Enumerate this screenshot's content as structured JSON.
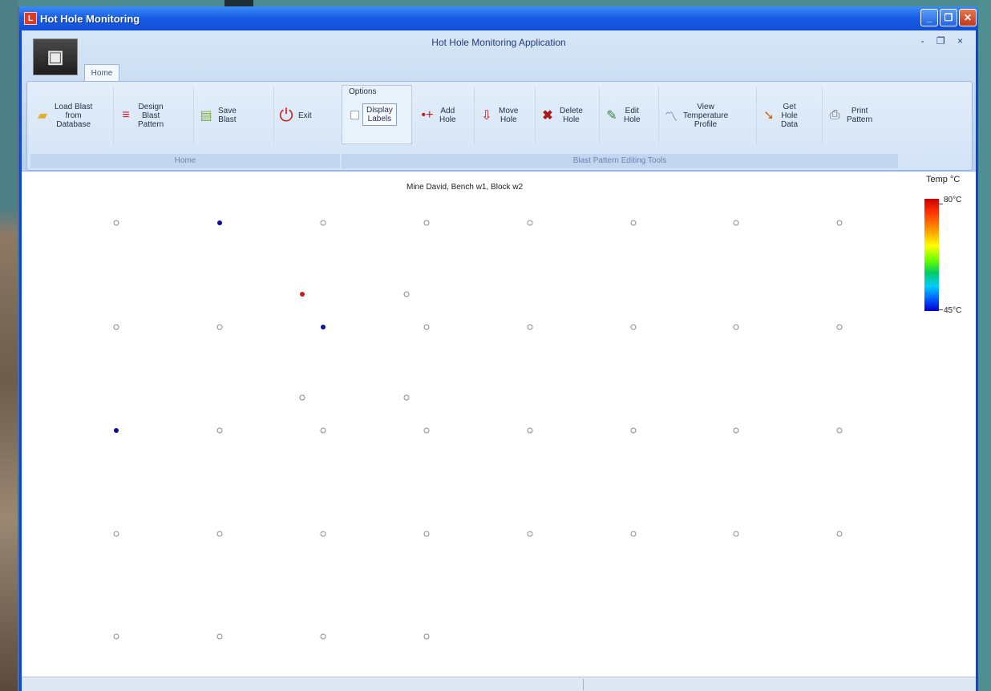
{
  "window": {
    "title": "Hot Hole Monitoring",
    "app_icon": "L",
    "buttons": {
      "minimize": "_",
      "maximize": "❐",
      "close": "✕"
    }
  },
  "ribbon": {
    "caption": "Hot Hole Monitoring Application",
    "mdi_buttons": "- ❐ ×",
    "tab": "Home",
    "groups": {
      "home_label": "Home",
      "tools_label": "Blast Pattern Editing Tools"
    },
    "buttons": {
      "load": "Load Blast\nfrom\nDatabase",
      "design": "Design\nBlast\nPattern",
      "save": "Save\nBlast",
      "exit": "Exit",
      "add_hole": "Add\nHole",
      "move_hole": "Move\nHole",
      "delete_hole": "Delete\nHole",
      "edit_hole": "Edit\nHole",
      "view_temp": "View\nTemperature\nProfile",
      "get_data": "Get\nHole\nData",
      "print": "Print\nPattern"
    },
    "options": {
      "title": "Options",
      "display_labels": "Display\nLabels"
    }
  },
  "canvas": {
    "caption": "Mine David, Bench w1, Block w2",
    "holes": [
      {
        "c": "#ffffff"
      },
      {
        "c": "#0a0a9a"
      },
      {
        "c": "#ffffff"
      },
      {
        "c": "#ffffff"
      },
      {
        "c": "#ffffff"
      },
      {
        "c": "#ffffff"
      },
      {
        "c": "#ffffff"
      },
      {
        "c": "#ffffff"
      },
      {
        "c": "#c41e1e"
      },
      {
        "c": "#ffffff"
      },
      {
        "c": "#ffffff"
      },
      {
        "c": "#ffffff"
      },
      {
        "c": "#0a0a9a"
      },
      {
        "c": "#ffffff"
      },
      {
        "c": "#ffffff"
      },
      {
        "c": "#ffffff"
      },
      {
        "c": "#ffffff"
      },
      {
        "c": "#ffffff"
      },
      {
        "c": "#ffffff"
      },
      {
        "c": "#ffffff"
      },
      {
        "c": "#0a0a9a"
      },
      {
        "c": "#ffffff"
      },
      {
        "c": "#ffffff"
      },
      {
        "c": "#ffffff"
      },
      {
        "c": "#ffffff"
      },
      {
        "c": "#ffffff"
      },
      {
        "c": "#ffffff"
      },
      {
        "c": "#ffffff"
      },
      {
        "c": "#ffffff"
      },
      {
        "c": "#ffffff"
      },
      {
        "c": "#ffffff"
      },
      {
        "c": "#ffffff"
      },
      {
        "c": "#ffffff"
      },
      {
        "c": "#ffffff"
      },
      {
        "c": "#ffffff"
      },
      {
        "c": "#ffffff"
      },
      {
        "c": "#ffffff"
      },
      {
        "c": "#ffffff"
      },
      {
        "c": "#ffffff"
      },
      {
        "c": "#ffffff"
      }
    ]
  },
  "legend": {
    "title": "Temp °C",
    "max": "80°C",
    "min": "45°C"
  }
}
